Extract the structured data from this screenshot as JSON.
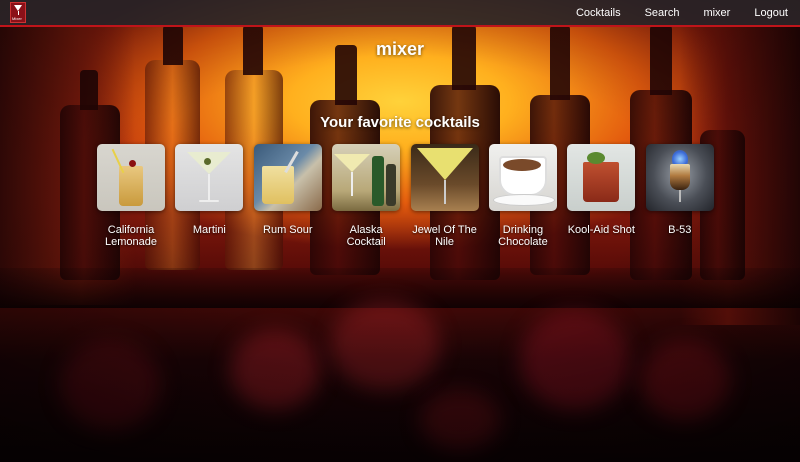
{
  "nav": {
    "logo_label": "Mixer",
    "links": [
      "Cocktails",
      "Search",
      "mixer",
      "Logout"
    ]
  },
  "page": {
    "title": "mixer",
    "section_title": "Your favorite cocktails"
  },
  "cocktails": [
    {
      "name": "California Lemonade"
    },
    {
      "name": "Martini"
    },
    {
      "name": "Rum Sour"
    },
    {
      "name": "Alaska Cocktail"
    },
    {
      "name": "Jewel Of The Nile"
    },
    {
      "name": "Drinking Chocolate"
    },
    {
      "name": "Kool-Aid Shot"
    },
    {
      "name": "B-53"
    }
  ],
  "colors": {
    "navbar_border": "#c0141a",
    "logo_bg": "#8b1018"
  }
}
